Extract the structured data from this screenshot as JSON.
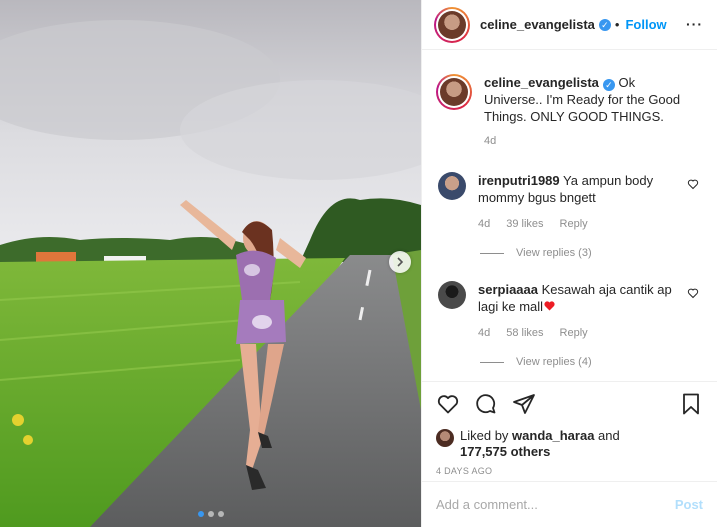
{
  "post": {
    "username": "celine_evangelista",
    "separator": "•",
    "follow_label": "Follow",
    "more_label": "···",
    "caption": "Ok Universe.. I'm Ready for the Good Things. ONLY GOOD THINGS.",
    "caption_age": "4d"
  },
  "comments": [
    {
      "user": "irenputri1989",
      "text": "Ya ampun body mommy bgus bngett",
      "age": "4d",
      "likes": "39 likes",
      "reply": "Reply",
      "view_replies": "View replies (3)",
      "avatar_color": "#3a4a6b"
    },
    {
      "user": "serpiaaaa",
      "text": "Kesawah aja cantik ap lagi ke mall",
      "age": "4d",
      "likes": "58 likes",
      "reply": "Reply",
      "view_replies": "View replies (4)",
      "avatar_color": "#2d2d2d"
    }
  ],
  "likes": {
    "prefix": "Liked by",
    "user": "wanda_haraa",
    "and": "and",
    "others": "177,575 others"
  },
  "date": "4 DAYS AGO",
  "add_comment": {
    "placeholder": "Add a comment...",
    "post_label": "Post"
  },
  "carousel": {
    "count": 3,
    "active": 1
  },
  "colors": {
    "accent": "#0095f6",
    "verified": "#3897f0",
    "muted": "#8e8e8e",
    "heart": "#ed1c24"
  },
  "icons": [
    "heart-icon",
    "comment-icon",
    "share-icon",
    "save-icon",
    "chevron-right-icon",
    "verified-icon"
  ]
}
